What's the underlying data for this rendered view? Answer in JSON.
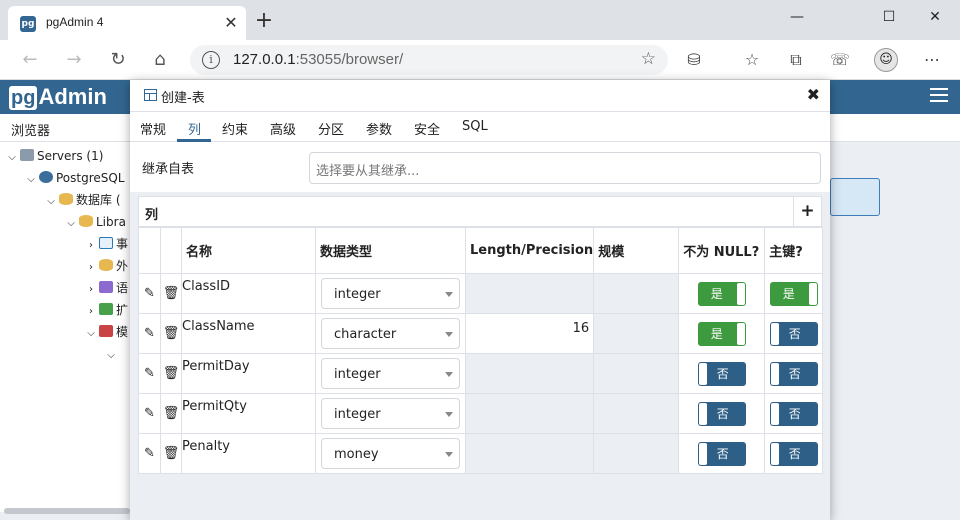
{
  "browser": {
    "tab_title": "pgAdmin 4",
    "tab_favicon": "pg",
    "url_host": "127.0.0.1",
    "url_rest": ":53055/browser/"
  },
  "app": {
    "logo_pg": "pg",
    "logo_text": "Admin",
    "panel_tab": "浏览器",
    "tree": [
      {
        "label": "Servers (1)",
        "icon": "server-icon"
      },
      {
        "label": "PostgreSQL",
        "icon": "postgres-icon"
      },
      {
        "label": "数据库 (",
        "icon": "database-icon"
      },
      {
        "label": "Libra",
        "icon": "database-icon"
      },
      {
        "label": "事",
        "icon": "event-trigger-icon"
      },
      {
        "label": "外",
        "icon": "foreign-data-icon"
      },
      {
        "label": "语",
        "icon": "language-icon"
      },
      {
        "label": "扩",
        "icon": "extension-icon"
      },
      {
        "label": "模",
        "icon": "schema-icon"
      }
    ]
  },
  "dialog": {
    "title": "创建-表",
    "tabs": [
      "常规",
      "列",
      "约束",
      "高级",
      "分区",
      "参数",
      "安全",
      "SQL"
    ],
    "active_tab": "列",
    "inherit_label": "继承自表",
    "inherit_placeholder": "选择要从其继承...",
    "columns_section_label": "列",
    "headers": {
      "name": "名称",
      "datatype": "数据类型",
      "length": "Length/Precision",
      "scale": "规模",
      "notnull": "不为 NULL?",
      "pk": "主键?"
    },
    "rows": [
      {
        "name": "ClassID",
        "type": "integer",
        "length": "",
        "scale": "",
        "notnull": "是",
        "pk": "是"
      },
      {
        "name": "ClassName",
        "type": "character",
        "length": "16",
        "scale": "",
        "notnull": "是",
        "pk": "否"
      },
      {
        "name": "PermitDay",
        "type": "integer",
        "length": "",
        "scale": "",
        "notnull": "否",
        "pk": "否"
      },
      {
        "name": "PermitQty",
        "type": "integer",
        "length": "",
        "scale": "",
        "notnull": "否",
        "pk": "否"
      },
      {
        "name": "Penalty",
        "type": "money",
        "length": "",
        "scale": "",
        "notnull": "否",
        "pk": "否"
      }
    ]
  },
  "colors": {
    "brand": "#326690",
    "toggle_on": "#3d9a3f",
    "toggle_off": "#2e5f87"
  }
}
